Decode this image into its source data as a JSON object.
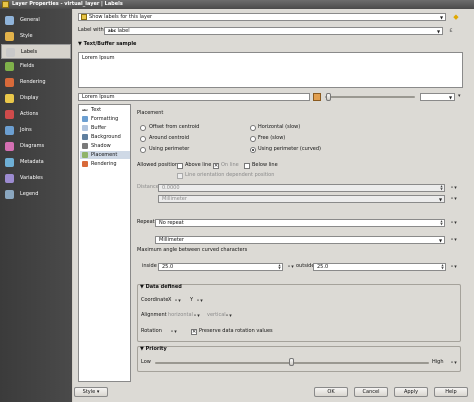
{
  "window": {
    "title": "Layer Properties - virtual_layer | Labels"
  },
  "nav": {
    "items": [
      {
        "label": "General",
        "color": "#8fb3d9"
      },
      {
        "label": "Style",
        "color": "#e2b24a"
      },
      {
        "label": "Labels",
        "color": "#c9c9c9"
      },
      {
        "label": "Fields",
        "color": "#7fb04a"
      },
      {
        "label": "Rendering",
        "color": "#d86a3a"
      },
      {
        "label": "Display",
        "color": "#e9c74a"
      },
      {
        "label": "Actions",
        "color": "#cf4b4b"
      },
      {
        "label": "Joins",
        "color": "#6c9fd1"
      },
      {
        "label": "Diagrams",
        "color": "#d36fb2"
      },
      {
        "label": "Metadata",
        "color": "#6fb0d6"
      },
      {
        "label": "Variables",
        "color": "#9c8bd0"
      },
      {
        "label": "Legend",
        "color": "#8aa7c0"
      }
    ],
    "active_index": 2
  },
  "top": {
    "mode_value": "Show labels for this layer",
    "label_with": "Label with",
    "field_prefix": "abc",
    "field_value": "label"
  },
  "text_buffer_sample": {
    "title": "Text/Buffer sample",
    "preview_text": "Lorem Ipsum",
    "sample_input": "Lorem Ipsum"
  },
  "subnav": {
    "items": [
      {
        "label": "Text",
        "icon": "abc",
        "color": "#ffffff"
      },
      {
        "label": "Formatting",
        "color": "#6c9fd1"
      },
      {
        "label": "Buffer",
        "color": "#b0c4de"
      },
      {
        "label": "Background",
        "color": "#5f7f9f"
      },
      {
        "label": "Shadow",
        "color": "#7a7a7a"
      },
      {
        "label": "Placement",
        "color": "#8fb36a"
      },
      {
        "label": "Rendering",
        "color": "#d86a3a"
      }
    ],
    "active_index": 5
  },
  "placement": {
    "title": "Placement",
    "modes": [
      {
        "label": "Offset from centroid",
        "checked": false
      },
      {
        "label": "Horizontal (slow)",
        "checked": false
      },
      {
        "label": "Around centroid",
        "checked": false
      },
      {
        "label": "Free (slow)",
        "checked": false
      },
      {
        "label": "Using perimeter",
        "checked": false
      },
      {
        "label": "Using perimeter (curved)",
        "checked": true
      }
    ],
    "allowed_positions": "Allowed positions",
    "above_line": "Above line",
    "on_line": "On line",
    "below_line": "Below line",
    "line_orientation": "Line orientation dependent position",
    "distance_label": "Distance",
    "distance_value": "0.0000",
    "distance_unit": "Millimeter",
    "repeat_label": "Repeat",
    "repeat_value": "No repeat",
    "repeat_unit": "Millimeter",
    "max_angle_label": "Maximum angle between curved characters",
    "inside_label": "inside",
    "inside_value": "25.0",
    "outside_label": "outside",
    "outside_value": "25.0"
  },
  "data_defined": {
    "title": "Data defined",
    "coordinate": "Coordinate",
    "x": "X",
    "y": "Y",
    "alignment": "Alignment",
    "horizontal": "horizontal",
    "vertical": "vertical",
    "rotation": "Rotation",
    "preserve_rotation": "Preserve data rotation values"
  },
  "priority": {
    "title": "Priority",
    "low": "Low",
    "high": "High",
    "level": 0.5
  },
  "footer": {
    "style": "Style",
    "ok": "OK",
    "cancel": "Cancel",
    "apply": "Apply",
    "help": "Help"
  }
}
